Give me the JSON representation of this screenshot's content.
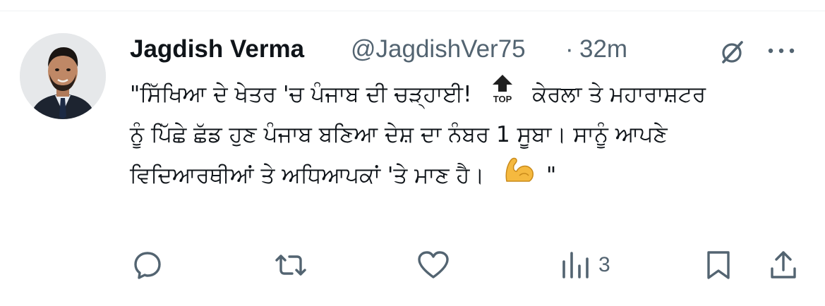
{
  "tweet": {
    "author_name": "Jagdish Verma",
    "handle": "@JagdishVer75",
    "separator": "·",
    "time": "32m",
    "text_lines": [
      "\"ਸਿੱਖਿਆ ਦੇ ਖੇਤਰ 'ਚ ਪੰਜਾਬ ਦੀ ਚੜ੍ਹਾਈ!",
      "ਕੇਰਲਾ ਤੇ ਮਹਾਰਾਸ਼ਟਰ",
      "ਨੂੰ ਪਿੱਛੇ ਛੱਡ ਹੁਣ ਪੰਜਾਬ ਬਣਿਆ ਦੇਸ਼ ਦਾ ਨੰਬਰ 1 ਸੂਬਾ। ਸਾਨੂੰ ਆਪਣੇ",
      "ਵਿਦਿਆਰਥੀਆਂ ਤੇ ਅਧਿਆਪਕਾਂ 'ਤੇ ਮਾਣ ਹੈ।",
      "\""
    ],
    "top_emoji_label": "TOP",
    "views_count": "3"
  },
  "icons": {
    "grok": "grok-icon",
    "more": "more-icon",
    "reply": "reply-icon",
    "retweet": "retweet-icon",
    "like": "like-icon",
    "views": "views-icon",
    "bookmark": "bookmark-icon",
    "share": "share-icon",
    "top_emoji": "top-arrow-emoji",
    "muscle_emoji": "flexed-biceps-emoji"
  },
  "colors": {
    "text_primary": "#0f1419",
    "text_secondary": "#536471",
    "emoji_yellow": "#f5b93f"
  }
}
